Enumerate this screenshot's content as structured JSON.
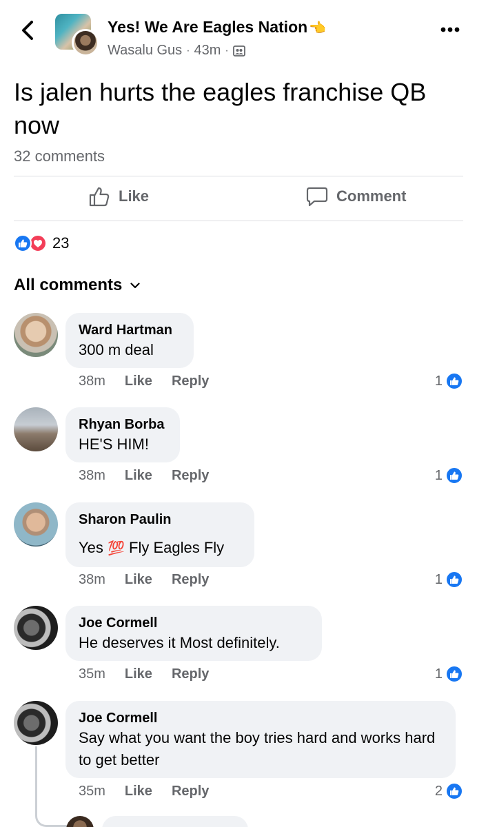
{
  "header": {
    "group_name": "Yes! We Are Eagles Nation",
    "group_name_emoji": "👈",
    "author": "Wasalu Gus",
    "time": "43m",
    "separator": "·"
  },
  "post": {
    "text": "Is jalen hurts the eagles franchise QB now",
    "comment_count": "32 comments"
  },
  "actions": {
    "like_label": "Like",
    "comment_label": "Comment"
  },
  "reactions": {
    "count": "23"
  },
  "comments_filter": {
    "label": "All comments"
  },
  "comments": [
    {
      "name": "Ward Hartman",
      "text": "300 m deal",
      "time": "38m",
      "like": "Like",
      "reply": "Reply",
      "likes": "1"
    },
    {
      "name": "Rhyan Borba",
      "text": "HE'S HIM!",
      "time": "38m",
      "like": "Like",
      "reply": "Reply",
      "likes": "1"
    },
    {
      "name": "Sharon Paulin",
      "text_before": "Yes ",
      "emoji": "💯",
      "text_after": " Fly Eagles Fly",
      "time": "38m",
      "like": "Like",
      "reply": "Reply",
      "likes": "1"
    },
    {
      "name": "Joe Cormell",
      "text": "He deserves it Most definitely.",
      "time": "35m",
      "like": "Like",
      "reply": "Reply",
      "likes": "1"
    },
    {
      "name": "Joe Cormell",
      "text": "Say what you want the boy tries hard and works hard to get better",
      "time": "35m",
      "like": "Like",
      "reply": "Reply",
      "likes": "2"
    }
  ],
  "colors": {
    "accent_blue": "#1877f2",
    "love_red": "#f33e58",
    "secondary_text": "#65676b",
    "bubble_bg": "#f0f2f5"
  }
}
